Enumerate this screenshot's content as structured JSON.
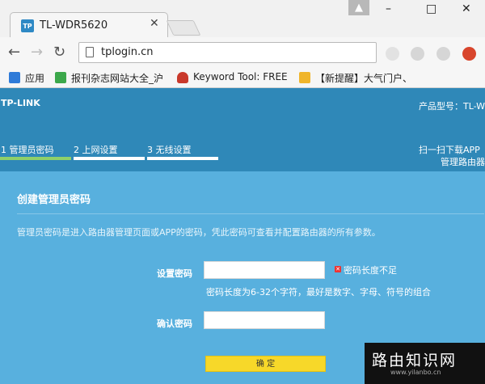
{
  "browser": {
    "tab_title": "TL-WDR5620",
    "tab_favicon": "TP",
    "tab_close": "✕",
    "url": "tplogin.cn",
    "window_minimize": "–",
    "window_maximize": "□",
    "window_close": "✕",
    "bookmarks": [
      {
        "label": "应用",
        "icon": "apps-grid-icon",
        "color": "#2f7bd8"
      },
      {
        "label": "报刊杂志网站大全_沪",
        "icon": "bookmark-green-icon",
        "color": "#3ca84b"
      },
      {
        "label": "Keyword Tool: FREE",
        "icon": "flame-icon",
        "color": "#c9392b"
      },
      {
        "label": "【新提醒】大气门户、",
        "icon": "trophy-icon",
        "color": "#f0b52b"
      }
    ]
  },
  "router": {
    "logo": "TP-LINK",
    "model_label": "产品型号：TL-W",
    "steps": [
      {
        "label": "1 管理员密码",
        "active": true
      },
      {
        "label": "2 上网设置",
        "active": false
      },
      {
        "label": "3 无线设置",
        "active": false
      }
    ],
    "qr_line1": "扫一扫下载APP",
    "qr_line2": "管理路由器",
    "form": {
      "title": "创建管理员密码",
      "description": "管理员密码是进入路由器管理页面或APP的密码，凭此密码可查看并配置路由器的所有参数。",
      "password_label": "设置密码",
      "password_value": "",
      "error_text": "密码长度不足",
      "hint": "密码长度为6-32个字符，最好是数字、字母、符号的组合",
      "confirm_label": "确认密码",
      "confirm_value": "",
      "submit_label": "确 定"
    }
  },
  "watermark": {
    "main": "路由知识网",
    "sub": "www.yilanbo.cn"
  },
  "colors": {
    "header_bg": "#2f88b8",
    "content_bg": "#58b0de",
    "active_step": "#8ed06a",
    "button": "#f7d829"
  }
}
